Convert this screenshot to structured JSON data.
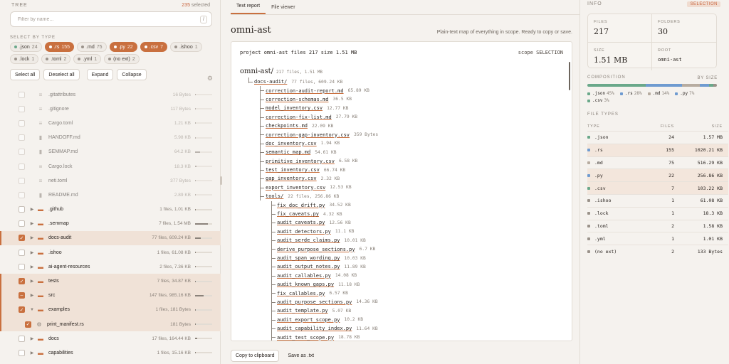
{
  "left": {
    "title": "TREE",
    "selected_count": "235",
    "selected_suffix": " selected",
    "filter_placeholder": "Filter by name...",
    "filter_kbd": "/",
    "select_by_type": "SELECT BY TYPE",
    "chips": [
      {
        "label": ".json",
        "count": "24",
        "on": false,
        "color": "#6aa88a"
      },
      {
        "label": ".rs",
        "count": "155",
        "on": true,
        "color": "#6f9bd0"
      },
      {
        "label": ".md",
        "count": "75",
        "on": false,
        "color": "#9a928a"
      },
      {
        "label": ".py",
        "count": "22",
        "on": true,
        "color": "#6f9bd0"
      },
      {
        "label": ".csv",
        "count": "7",
        "on": true,
        "color": "#6aa88a"
      },
      {
        "label": ".ishoo",
        "count": "1",
        "on": false,
        "color": "#9a928a"
      },
      {
        "label": ".lock",
        "count": "1",
        "on": false,
        "color": "#9a928a"
      },
      {
        "label": ".toml",
        "count": "2",
        "on": false,
        "color": "#9a928a"
      },
      {
        "label": ".yml",
        "count": "1",
        "on": false,
        "color": "#9a928a"
      },
      {
        "label": "(no ext)",
        "count": "2",
        "on": false,
        "color": "#9a928a"
      }
    ],
    "buttons": {
      "select_all": "Select all",
      "deselect_all": "Deselect all",
      "expand": "Expand",
      "collapse": "Collapse"
    },
    "rows": [
      {
        "name": ".gitattributes",
        "meta": "16 Bytes",
        "type": "lines",
        "state": "none",
        "folder": false,
        "expanded": false,
        "dim": true,
        "bar": 0.02
      },
      {
        "name": ".gitignore",
        "meta": "117 Bytes",
        "type": "lines",
        "state": "none",
        "folder": false,
        "expanded": false,
        "dim": true,
        "bar": 0.03
      },
      {
        "name": "Cargo.toml",
        "meta": "1.21 KB",
        "type": "lines",
        "state": "none",
        "folder": false,
        "expanded": false,
        "dim": true,
        "bar": 0.04
      },
      {
        "name": "HANDOFF.md",
        "meta": "5.98 KB",
        "type": "file",
        "state": "none",
        "folder": false,
        "expanded": false,
        "dim": true,
        "bar": 0.06
      },
      {
        "name": "SEMMAP.md",
        "meta": "64.2 KB",
        "type": "file",
        "state": "none",
        "folder": false,
        "expanded": false,
        "dim": true,
        "bar": 0.3
      },
      {
        "name": "Cargo.lock",
        "meta": "18.3 KB",
        "type": "lines",
        "state": "none",
        "folder": false,
        "expanded": false,
        "dim": true,
        "bar": 0.1
      },
      {
        "name": "neti.toml",
        "meta": "377 Bytes",
        "type": "lines",
        "state": "none",
        "folder": false,
        "expanded": false,
        "dim": true,
        "bar": 0.03
      },
      {
        "name": "README.md",
        "meta": "2.89 KB",
        "type": "file",
        "state": "none",
        "folder": false,
        "expanded": false,
        "dim": true,
        "bar": 0.04
      },
      {
        "name": ".github",
        "meta": "1 files, 1.01 KB",
        "type": "folder",
        "state": "none",
        "folder": true,
        "expanded": false,
        "dim": false,
        "bar": 0.03
      },
      {
        "name": ".semmap",
        "meta": "7 files, 1.54 MB",
        "type": "folder",
        "state": "none",
        "folder": true,
        "expanded": false,
        "dim": false,
        "bar": 0.75
      },
      {
        "name": "docs-audit",
        "meta": "77 files, 609.24 KB",
        "type": "folder",
        "state": "checked",
        "folder": true,
        "expanded": false,
        "dim": false,
        "bar": 0.35
      },
      {
        "name": ".ishoo",
        "meta": "1 files, 61.08 KB",
        "type": "folder",
        "state": "none",
        "folder": true,
        "expanded": false,
        "dim": false,
        "bar": 0.05
      },
      {
        "name": "ai-agent-resources",
        "meta": "2 files, 7.36 KB",
        "type": "folder",
        "state": "none",
        "folder": true,
        "expanded": false,
        "dim": false,
        "bar": 0.03
      },
      {
        "name": "tests",
        "meta": "7 files, 34.87 KB",
        "type": "folder",
        "state": "checked",
        "folder": true,
        "expanded": false,
        "dim": false,
        "bar": 0.06
      },
      {
        "name": "src",
        "meta": "147 files, 985.16 KB",
        "type": "folder",
        "state": "partial",
        "folder": true,
        "expanded": false,
        "dim": false,
        "bar": 0.5
      },
      {
        "name": "examples",
        "meta": "1 files, 181 Bytes",
        "type": "folder",
        "state": "checked",
        "folder": true,
        "expanded": true,
        "dim": false,
        "bar": 0.02
      },
      {
        "name": "print_manifest.rs",
        "meta": "181 Bytes",
        "type": "rs",
        "state": "checked",
        "folder": false,
        "expanded": false,
        "dim": false,
        "bar": 0.02,
        "child": true
      },
      {
        "name": "docs",
        "meta": "17 files, 164.44 KB",
        "type": "folder",
        "state": "none",
        "folder": true,
        "expanded": false,
        "dim": false,
        "bar": 0.12
      },
      {
        "name": "capabilities",
        "meta": "1 files, 15.16 KB",
        "type": "folder",
        "state": "none",
        "folder": true,
        "expanded": false,
        "dim": false,
        "bar": 0.03
      }
    ]
  },
  "mid": {
    "tabs": [
      "Text report",
      "File viewer"
    ],
    "project": "omni-ast",
    "lede": "Plain-text map of everything in scope. Ready to copy or save.",
    "report_head_left": "project omni-ast files 217 size 1.51 MB",
    "report_head_right": "scope SELECTION",
    "root": {
      "name": "omni-ast/",
      "meta": "217 files, 1.51 MB"
    },
    "lines": [
      {
        "d": 1,
        "n": "docs-audit/",
        "s": "77 files, 609.24 KB"
      },
      {
        "d": 2,
        "n": "correction-audit-report.md",
        "s": "65.89 KB"
      },
      {
        "d": 2,
        "n": "correction-schemas.md",
        "s": "36.5 KB"
      },
      {
        "d": 2,
        "n": "model_inventory.csv",
        "s": "12.77 KB"
      },
      {
        "d": 2,
        "n": "correction-fix-list.md",
        "s": "27.79 KB"
      },
      {
        "d": 2,
        "n": "checkpoints.md",
        "s": "22.09 KB"
      },
      {
        "d": 2,
        "n": "correction-gap-inventory.csv",
        "s": "359 Bytes"
      },
      {
        "d": 2,
        "n": "doc_inventory.csv",
        "s": "1.94 KB"
      },
      {
        "d": 2,
        "n": "semantic_map.md",
        "s": "54.61 KB"
      },
      {
        "d": 2,
        "n": "primitive_inventory.csv",
        "s": "6.58 KB"
      },
      {
        "d": 2,
        "n": "test_inventory.csv",
        "s": "66.74 KB"
      },
      {
        "d": 2,
        "n": "gap_inventory.csv",
        "s": "2.32 KB"
      },
      {
        "d": 2,
        "n": "export_inventory.csv",
        "s": "12.53 KB"
      },
      {
        "d": 2,
        "n": "tools/",
        "s": "22 files, 256.86 KB"
      },
      {
        "d": 3,
        "n": "fix_doc_drift.py",
        "s": "34.52 KB"
      },
      {
        "d": 3,
        "n": "fix_caveats.py",
        "s": "4.32 KB"
      },
      {
        "d": 3,
        "n": "audit_caveats.py",
        "s": "12.56 KB"
      },
      {
        "d": 3,
        "n": "audit_detectors.py",
        "s": "11.1 KB"
      },
      {
        "d": 3,
        "n": "audit_serde_claims.py",
        "s": "10.01 KB"
      },
      {
        "d": 3,
        "n": "derive_purpose_sections.py",
        "s": "6.7 KB"
      },
      {
        "d": 3,
        "n": "audit_span_wording.py",
        "s": "10.03 KB"
      },
      {
        "d": 3,
        "n": "audit_output_notes.py",
        "s": "11.89 KB"
      },
      {
        "d": 3,
        "n": "audit_callables.py",
        "s": "14.08 KB"
      },
      {
        "d": 3,
        "n": "audit_known_gaps.py",
        "s": "11.18 KB"
      },
      {
        "d": 3,
        "n": "fix_callables.py",
        "s": "6.57 KB"
      },
      {
        "d": 3,
        "n": "audit_purpose_sections.py",
        "s": "14.36 KB"
      },
      {
        "d": 3,
        "n": "audit_template.py",
        "s": "5.07 KB"
      },
      {
        "d": 3,
        "n": "audit_export_scope.py",
        "s": "10.2 KB"
      },
      {
        "d": 3,
        "n": "audit_capability_index.py",
        "s": "11.64 KB"
      },
      {
        "d": 3,
        "n": "audit_test_scope.py",
        "s": "18.78 KB"
      }
    ],
    "copy": "Copy to clipboard",
    "save": "Save as .txt"
  },
  "right": {
    "title": "INFO",
    "badge": "SELECTION",
    "files_label": "FILES",
    "files_value": "217",
    "folders_label": "FOLDERS",
    "folders_value": "30",
    "size_label": "SIZE",
    "size_value": "1.51 MB",
    "root_label": "ROOT",
    "root_value": "omni-ast",
    "composition": "COMPOSITION",
    "by_size": "BY SIZE",
    "comp": [
      {
        "label": ".json",
        "pct": "45%",
        "frac": 0.45,
        "color": "#6aa88a"
      },
      {
        "label": ".rs",
        "pct": "28%",
        "frac": 0.28,
        "color": "#6f9bd0"
      },
      {
        "label": ".md",
        "pct": "14%",
        "frac": 0.14,
        "color": "#b7aca0"
      },
      {
        "label": ".py",
        "pct": "7%",
        "frac": 0.07,
        "color": "#6f9bd0"
      },
      {
        "label": ".csv",
        "pct": "3%",
        "frac": 0.03,
        "color": "#6aa88a"
      }
    ],
    "file_types": "FILE TYPES",
    "col_type": "TYPE",
    "col_files": "FILES",
    "col_size": "SIZE",
    "types": [
      {
        "t": ".json",
        "f": "24",
        "s": "1.57 MB",
        "hl": false,
        "color": "#6aa88a"
      },
      {
        "t": ".rs",
        "f": "155",
        "s": "1020.21 KB",
        "hl": true,
        "color": "#6f9bd0"
      },
      {
        "t": ".md",
        "f": "75",
        "s": "516.29 KB",
        "hl": false,
        "color": "#b7aca0"
      },
      {
        "t": ".py",
        "f": "22",
        "s": "256.86 KB",
        "hl": true,
        "color": "#6f9bd0"
      },
      {
        "t": ".csv",
        "f": "7",
        "s": "103.22 KB",
        "hl": true,
        "color": "#6aa88a"
      },
      {
        "t": ".ishoo",
        "f": "1",
        "s": "61.08 KB",
        "hl": false,
        "color": "#9a928a"
      },
      {
        "t": ".lock",
        "f": "1",
        "s": "18.3 KB",
        "hl": false,
        "color": "#9a928a"
      },
      {
        "t": ".toml",
        "f": "2",
        "s": "1.58 KB",
        "hl": false,
        "color": "#9a928a"
      },
      {
        "t": ".yml",
        "f": "1",
        "s": "1.01 KB",
        "hl": false,
        "color": "#9a928a"
      },
      {
        "t": "(no ext)",
        "f": "2",
        "s": "133 Bytes",
        "hl": false,
        "color": "#9a928a"
      }
    ]
  }
}
